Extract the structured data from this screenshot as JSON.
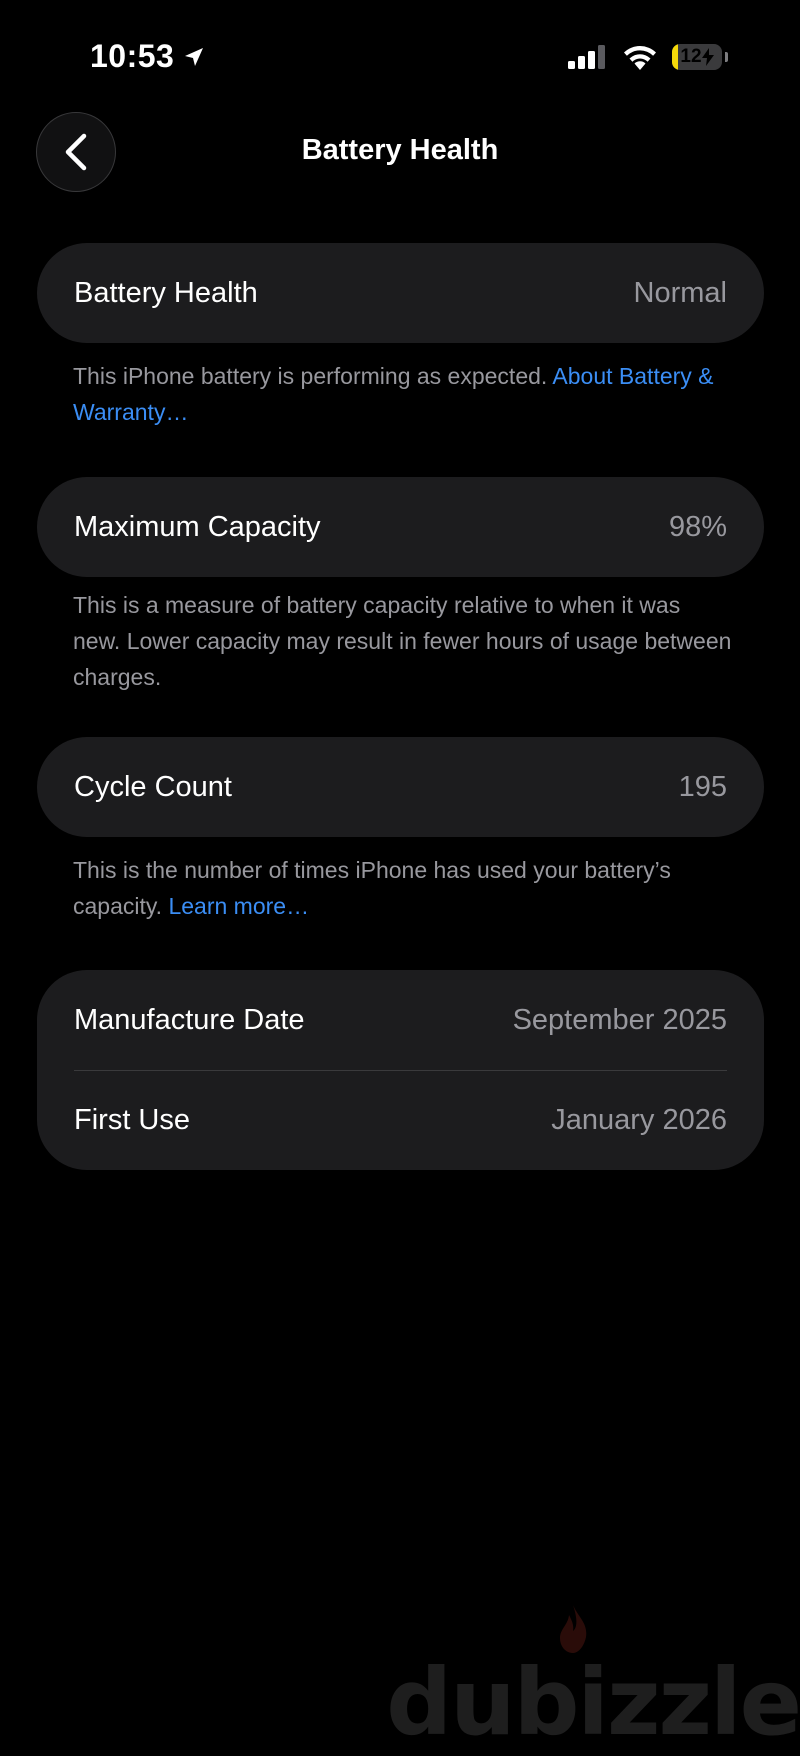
{
  "status_bar": {
    "time": "10:53",
    "battery_level": "12",
    "battery_fraction": 0.12,
    "battery_color": "#f5d90a"
  },
  "header": {
    "title": "Battery Health"
  },
  "battery_health": {
    "label": "Battery Health",
    "value": "Normal",
    "note_text": "This iPhone battery is performing as expected. ",
    "note_link": "About Battery & Warranty…"
  },
  "maximum_capacity": {
    "label": "Maximum Capacity",
    "value": "98%",
    "note_text": "This is a measure of battery capacity relative to when it was new. Lower capacity may result in fewer hours of usage between charges."
  },
  "cycle_count": {
    "label": "Cycle Count",
    "value": "195",
    "note_text": "This is the number of times iPhone has used your battery’s capacity. ",
    "note_link": "Learn more…"
  },
  "dates": {
    "manufacture_label": "Manufacture Date",
    "manufacture_value": "September 2025",
    "first_use_label": "First Use",
    "first_use_value": "January 2026"
  },
  "watermark": {
    "text": "dubizzle"
  },
  "colors": {
    "background": "#000000",
    "card": "#1c1c1e",
    "secondary_text": "#98989e",
    "link": "#3b8ef5"
  }
}
